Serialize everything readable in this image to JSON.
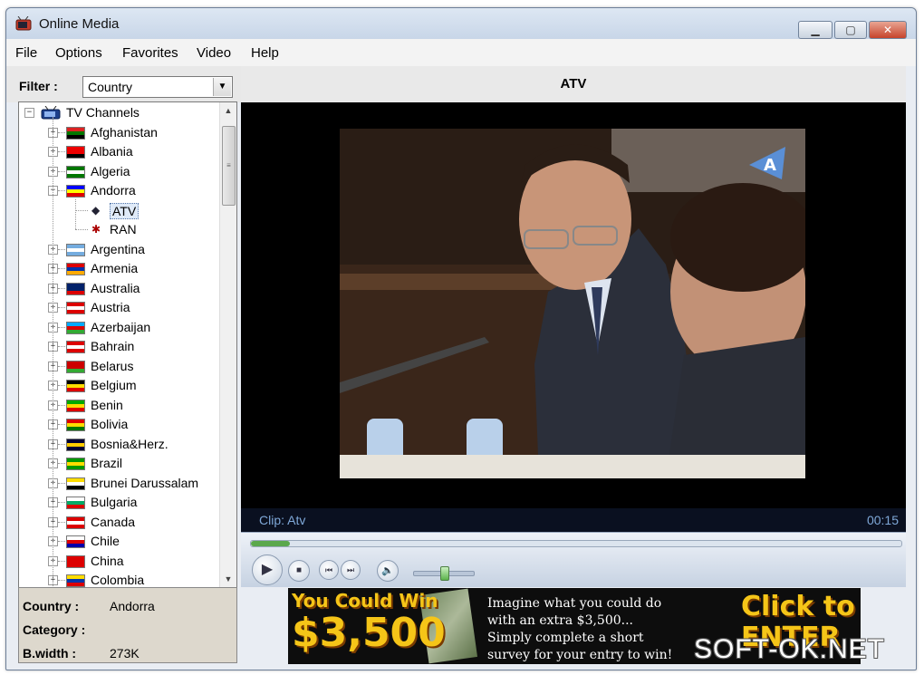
{
  "window": {
    "title": "Online Media"
  },
  "menu": [
    "File",
    "Options",
    "Favorites",
    "Video",
    "Help"
  ],
  "filter": {
    "label": "Filter :",
    "value": "Country"
  },
  "tree": {
    "root": "TV Channels",
    "countries": [
      {
        "label": "Afghanistan",
        "expanded": false
      },
      {
        "label": "Albania",
        "expanded": false
      },
      {
        "label": "Algeria",
        "expanded": false
      },
      {
        "label": "Andorra",
        "expanded": true
      },
      {
        "label": "Argentina",
        "expanded": false
      },
      {
        "label": "Armenia",
        "expanded": false
      },
      {
        "label": "Australia",
        "expanded": false
      },
      {
        "label": "Austria",
        "expanded": false
      },
      {
        "label": "Azerbaijan",
        "expanded": false
      },
      {
        "label": "Bahrain",
        "expanded": false
      },
      {
        "label": "Belarus",
        "expanded": false
      },
      {
        "label": "Belgium",
        "expanded": false
      },
      {
        "label": "Benin",
        "expanded": false
      },
      {
        "label": "Bolivia",
        "expanded": false
      },
      {
        "label": "Bosnia&Herz.",
        "expanded": false
      },
      {
        "label": "Brazil",
        "expanded": false
      },
      {
        "label": "Brunei Darussalam",
        "expanded": false
      },
      {
        "label": "Bulgaria",
        "expanded": false
      },
      {
        "label": "Canada",
        "expanded": false
      },
      {
        "label": "Chile",
        "expanded": false
      },
      {
        "label": "China",
        "expanded": false
      },
      {
        "label": "Colombia",
        "expanded": false
      }
    ],
    "channels": [
      {
        "label": "ATV",
        "selected": true
      },
      {
        "label": "RAN",
        "selected": false
      }
    ]
  },
  "info": {
    "country_label": "Country :",
    "country_value": "Andorra",
    "category_label": "Category :",
    "category_value": "",
    "bwidth_label": "B.width :",
    "bwidth_value": "273K"
  },
  "player": {
    "channel_title": "ATV",
    "clip_label": "Clip: Atv",
    "time": "00:15",
    "seek_progress": 0.06,
    "volume_level": 0.5
  },
  "ad": {
    "left_line1": "You Could Win",
    "left_line2": "$3,500",
    "mid_lines": [
      "Imagine what you could do",
      "with an extra $3,500...",
      "Simply complete a short",
      "survey for your entry to win!"
    ],
    "right_line1": "Click to",
    "right_line2": "ENTER"
  },
  "watermark": "SOFT-OK.NET",
  "colors": {
    "accent": "#5ba84c",
    "video_bg": "#000000",
    "clip_text": "#7fa8d8"
  }
}
